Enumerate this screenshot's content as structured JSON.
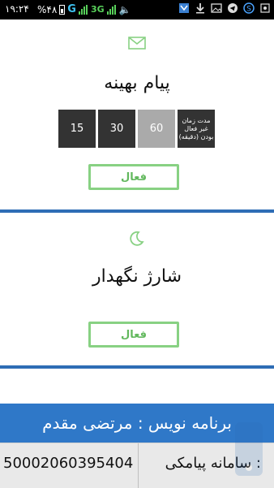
{
  "status_bar": {
    "time": "۱۹:۲۴",
    "battery_text": "%۴۸",
    "network_g": "G",
    "network_3g": "3G"
  },
  "smart_sms": {
    "title": "پیام بهینه",
    "time_options": [
      "15",
      "30",
      "60"
    ],
    "selected_option": "60",
    "time_label": "مدت زمان غیر فعال بودن (دقیقه)",
    "active_button": "فعال"
  },
  "battery_saver": {
    "title": "شارژ نگهدار",
    "active_button": "فعال"
  },
  "footer": {
    "programmer": "برنامه نویس : مرتضی مقدم",
    "sms_system_label": "سامانه پیامکی :",
    "sms_system_number": "50002060395404"
  },
  "colors": {
    "accent_blue": "#2e6db5",
    "button_green": "#88d183",
    "dark_box": "#333333",
    "selected_box": "#aaaaaa"
  },
  "icons": {
    "smart_sms": "envelope-icon",
    "battery_saver": "moon-icon"
  }
}
